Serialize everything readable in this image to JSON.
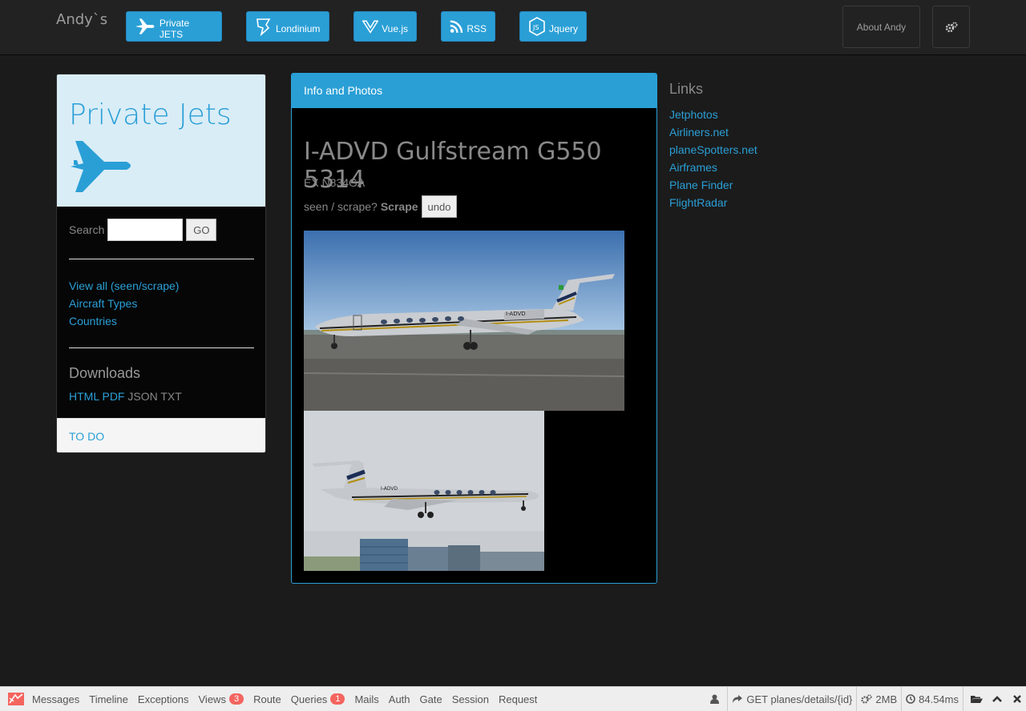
{
  "navbar": {
    "brand": "Andy`s",
    "buttons": [
      {
        "label": "Private JETS",
        "icon": "plane-icon"
      },
      {
        "label": "Londinium",
        "icon": "pen-icon"
      },
      {
        "label": "Vue.js",
        "icon": "vue-icon"
      },
      {
        "label": "RSS",
        "icon": "rss-icon"
      },
      {
        "label": "Jquery",
        "icon": "nodejs-icon"
      }
    ],
    "about": "About Andy",
    "settings_icon": "cogs-icon"
  },
  "left": {
    "title": "Private Jets",
    "search_label": "Search",
    "search_value": "",
    "go": "GO",
    "links": [
      "View all (seen/scrape)",
      "Aircraft Types",
      "Countries"
    ],
    "downloads_title": "Downloads",
    "downloads": {
      "html": "HTML",
      "pdf": "PDF",
      "json": "JSON",
      "txt": "TXT"
    },
    "footer": "TO DO"
  },
  "center": {
    "header": "Info and Photos",
    "title": "I-ADVD Gulfstream G550 5314",
    "ex": "EX N834GA",
    "seen_label": "seen / scrape?",
    "scrape": "Scrape",
    "undo": "undo",
    "photo_reg": "I-ADVD",
    "photo2_reg": "I-ADVD"
  },
  "right": {
    "title": "Links",
    "links": [
      "Jetphotos",
      "Airliners.net",
      "planeSpotters.net",
      "Airframes",
      "Plane Finder",
      "FlightRadar"
    ]
  },
  "debugbar": {
    "tabs": [
      {
        "label": "Messages"
      },
      {
        "label": "Timeline"
      },
      {
        "label": "Exceptions"
      },
      {
        "label": "Views",
        "badge": "3"
      },
      {
        "label": "Route"
      },
      {
        "label": "Queries",
        "badge": "1"
      },
      {
        "label": "Mails"
      },
      {
        "label": "Auth"
      },
      {
        "label": "Gate"
      },
      {
        "label": "Session"
      },
      {
        "label": "Request"
      }
    ],
    "route": "GET planes/details/{id}",
    "memory": "2MB",
    "time": "84.54ms"
  }
}
